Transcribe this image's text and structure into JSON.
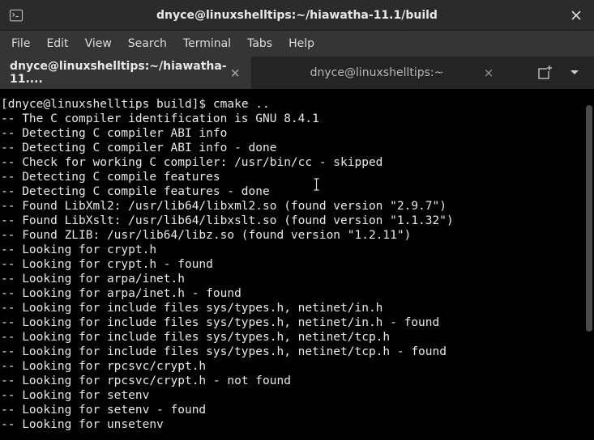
{
  "window": {
    "title": "dnyce@linuxshelltips:~/hiawatha-11.1/build"
  },
  "menubar": {
    "items": [
      "File",
      "Edit",
      "View",
      "Search",
      "Terminal",
      "Tabs",
      "Help"
    ]
  },
  "tabs": [
    {
      "label": "dnyce@linuxshelltips:~/hiawatha-11....",
      "active": true
    },
    {
      "label": "dnyce@linuxshelltips:~",
      "active": false
    }
  ],
  "terminal": {
    "prompt": "[dnyce@linuxshelltips build]$ ",
    "command": "cmake ..",
    "lines": [
      "-- The C compiler identification is GNU 8.4.1",
      "-- Detecting C compiler ABI info",
      "-- Detecting C compiler ABI info - done",
      "-- Check for working C compiler: /usr/bin/cc - skipped",
      "-- Detecting C compile features",
      "-- Detecting C compile features - done",
      "-- Found LibXml2: /usr/lib64/libxml2.so (found version \"2.9.7\")",
      "-- Found LibXslt: /usr/lib64/libxslt.so (found version \"1.1.32\")",
      "-- Found ZLIB: /usr/lib64/libz.so (found version \"1.2.11\")",
      "-- Looking for crypt.h",
      "-- Looking for crypt.h - found",
      "-- Looking for arpa/inet.h",
      "-- Looking for arpa/inet.h - found",
      "-- Looking for include files sys/types.h, netinet/in.h",
      "-- Looking for include files sys/types.h, netinet/in.h - found",
      "-- Looking for include files sys/types.h, netinet/tcp.h",
      "-- Looking for include files sys/types.h, netinet/tcp.h - found",
      "-- Looking for rpcsvc/crypt.h",
      "-- Looking for rpcsvc/crypt.h - not found",
      "-- Looking for setenv",
      "-- Looking for setenv - found",
      "-- Looking for unsetenv"
    ]
  }
}
